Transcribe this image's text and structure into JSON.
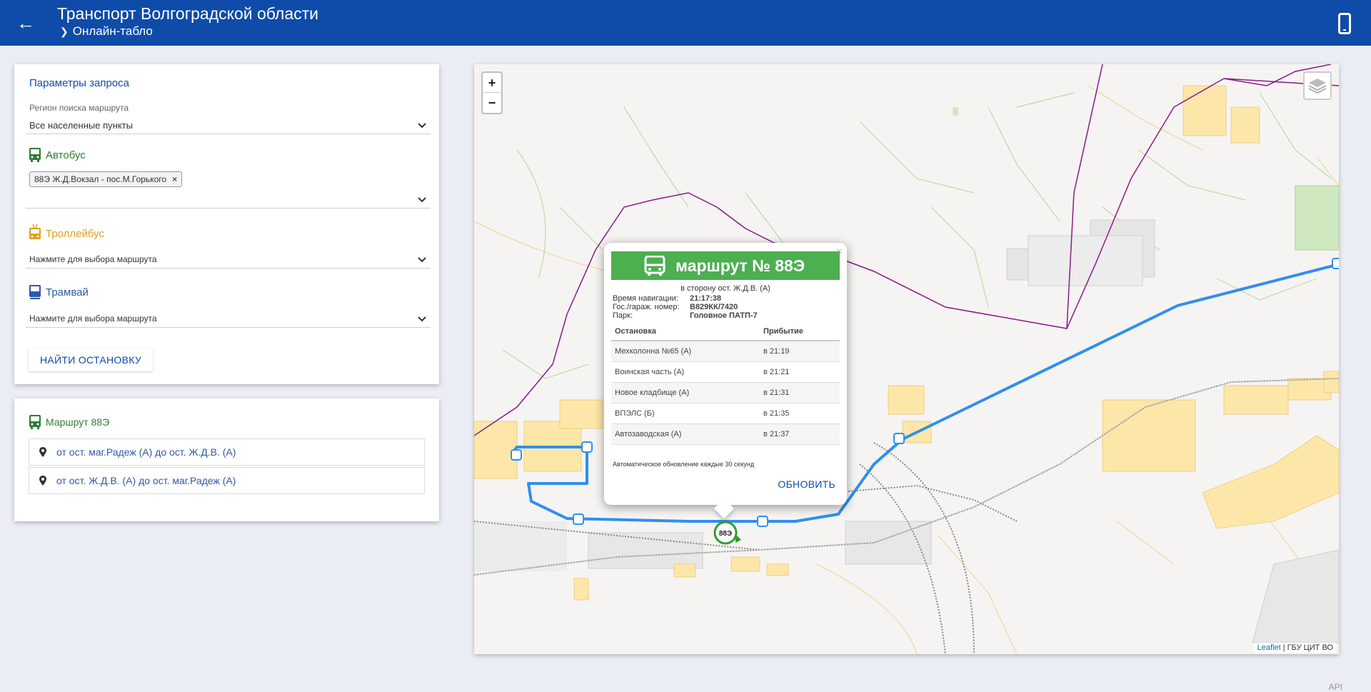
{
  "header": {
    "title": "Транспорт Волгоградской области",
    "subtitle": "Онлайн-табло"
  },
  "params": {
    "title": "Параметры запроса",
    "region_label": "Регион поиска маршрута",
    "region_value": "Все населенные пункты",
    "bus": {
      "title": "Автобус",
      "selected_tag": "88Э Ж.Д.Вокзал - пос.М.Горького"
    },
    "trolleybus": {
      "title": "Троллейбус",
      "placeholder": "Нажмите для выбора маршрута"
    },
    "tram": {
      "title": "Трамвай",
      "placeholder": "Нажмите для выбора маршрута"
    },
    "find_button": "НАЙТИ ОСТАНОВКУ"
  },
  "route": {
    "title": "Маршрут 88Э",
    "directions": [
      "от ост. маг.Радеж (А) до ост. Ж.Д.В. (А)",
      "от ост. Ж.Д.В. (А) до ост. маг.Радеж (А)"
    ]
  },
  "map": {
    "zoom_in": "+",
    "zoom_out": "−",
    "vehicle_label": "88Э",
    "attribution_link": "Leaflet",
    "attribution_text": " | ГБУ ЦИТ ВО",
    "colors": {
      "route_line": "#2f8ff0",
      "vehicle_ring": "#2e9e2e",
      "boundary": "#8b1a8b",
      "building": "#fde7a8"
    }
  },
  "popup": {
    "close": "×",
    "title": "маршрут № 88Э",
    "direction": "в сторону ост. Ж.Д.В. (А)",
    "nav_time_label": "Время навигации:",
    "nav_time_value": "21:17:38",
    "plate_label": "Гос./гараж. номер:",
    "plate_value": "В829КК/7420",
    "park_label": "Парк:",
    "park_value": "Головное ПАТП-7",
    "table_headers": [
      "Остановка",
      "Прибытие"
    ],
    "stops": [
      {
        "name": "Мехколонна №65 (А)",
        "arrival": "в 21:19"
      },
      {
        "name": "Воинская часть (А)",
        "arrival": "в 21:21"
      },
      {
        "name": "Новое кладбище (А)",
        "arrival": "в 21:31"
      },
      {
        "name": "ВПЭЛС (Б)",
        "arrival": "в 21:35"
      },
      {
        "name": "Автозаводская (А)",
        "arrival": "в 21:37"
      }
    ],
    "auto_note": "Автоматическое обновление каждые 30 секунд",
    "refresh_button": "ОБНОВИТЬ"
  },
  "footer": {
    "api_link": "API"
  }
}
